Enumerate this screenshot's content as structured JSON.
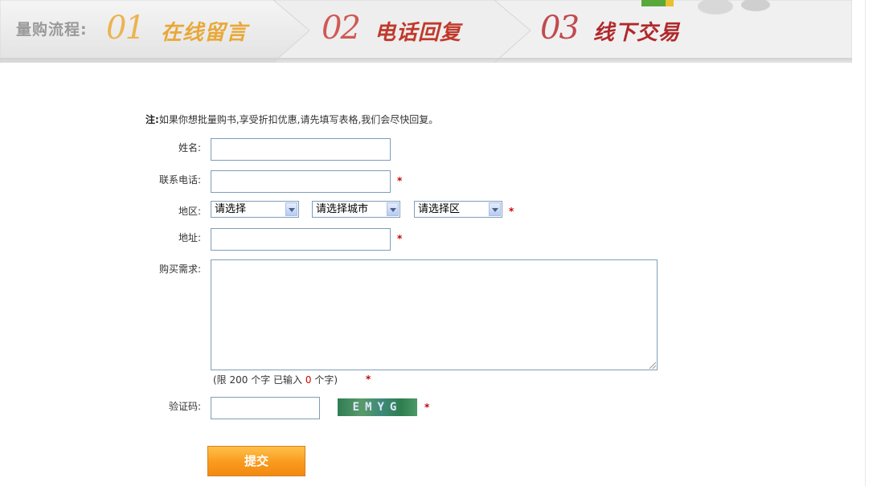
{
  "banner": {
    "label": "量购流程:",
    "steps": [
      {
        "num": "01",
        "text": "在线留言"
      },
      {
        "num": "02",
        "text": "电话回复"
      },
      {
        "num": "03",
        "text": "线下交易"
      }
    ]
  },
  "form": {
    "note_prefix": "注:",
    "note_text": "如果你想批量购书,享受折扣优惠,请先填写表格,我们会尽快回复。",
    "name_label": "姓名:",
    "phone_label": "联系电话:",
    "region_label": "地区:",
    "province_select": "请选择",
    "city_select": "请选择城市",
    "district_select": "请选择区",
    "address_label": "地址:",
    "demand_label": "购买需求:",
    "limit_prefix": "(限 200 个字 已输入",
    "limit_count": "0",
    "limit_suffix": "个字)",
    "captcha_label": "验证码:",
    "captcha_code": "EMYG",
    "required_mark": "*",
    "submit_label": "提交"
  },
  "colors": {
    "step1": "#e8a838",
    "step2": "#c0392b",
    "step3": "#b0282b",
    "required": "#cc0000",
    "submit": "#f99a1d"
  }
}
